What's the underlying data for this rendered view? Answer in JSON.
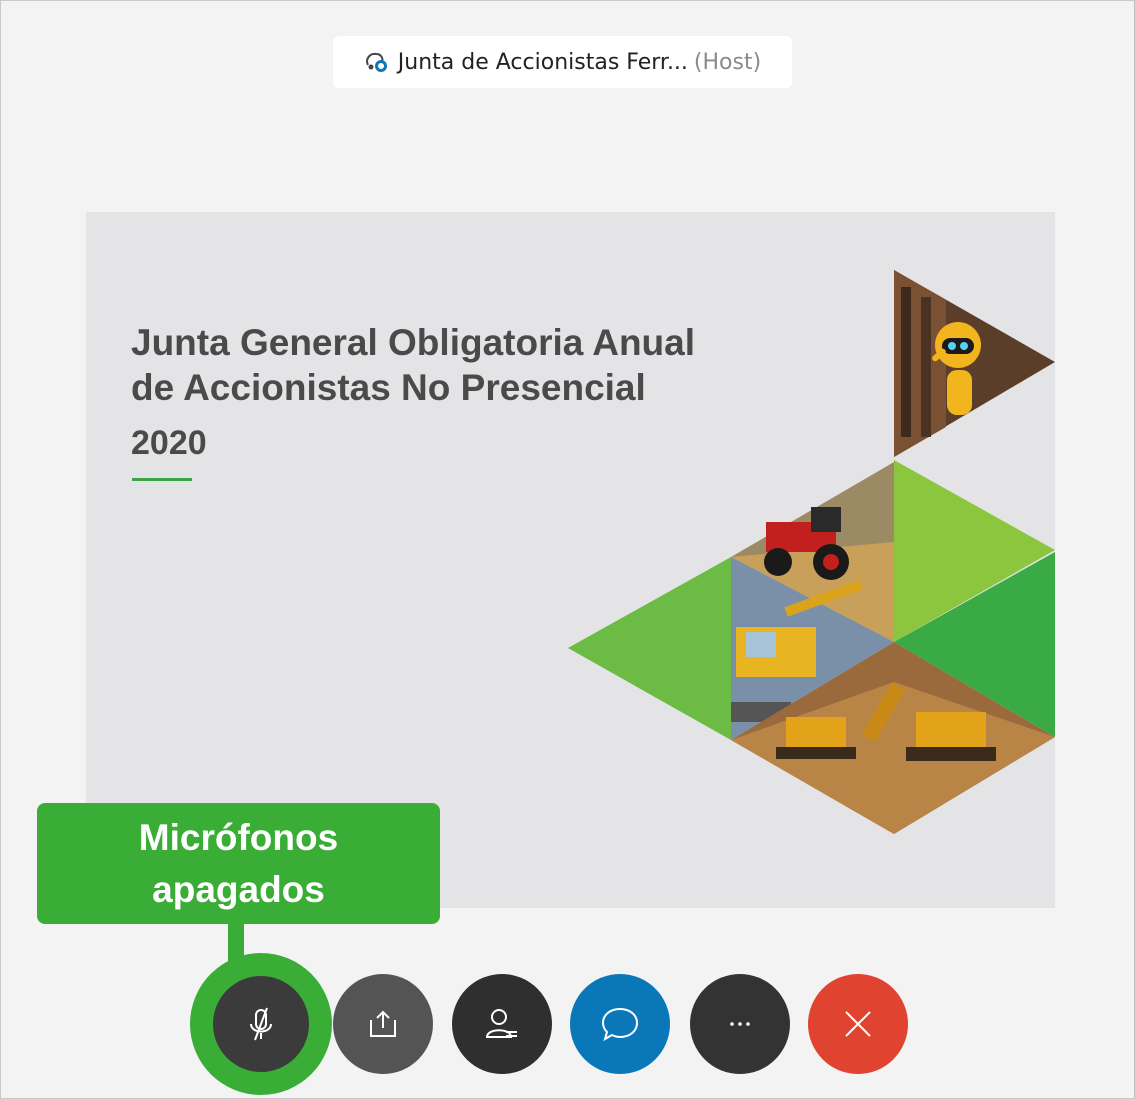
{
  "meeting": {
    "title": "Junta de Accionistas Ferr...",
    "role": "(Host)"
  },
  "slide": {
    "title_line1": "Junta General Obligatoria Anual",
    "title_line2": "de Accionistas No Presencial",
    "year": "2020",
    "accent_color": "#3aa545"
  },
  "callout": {
    "line1": "Micrófonos",
    "line2": "apagados",
    "color": "#3aad37"
  },
  "controls": [
    {
      "name": "microphone-muted",
      "icon": "mic-off-icon"
    },
    {
      "name": "share",
      "icon": "share-icon"
    },
    {
      "name": "participants",
      "icon": "participants-icon"
    },
    {
      "name": "chat",
      "icon": "chat-icon"
    },
    {
      "name": "more",
      "icon": "more-icon"
    },
    {
      "name": "leave",
      "icon": "close-icon"
    }
  ]
}
